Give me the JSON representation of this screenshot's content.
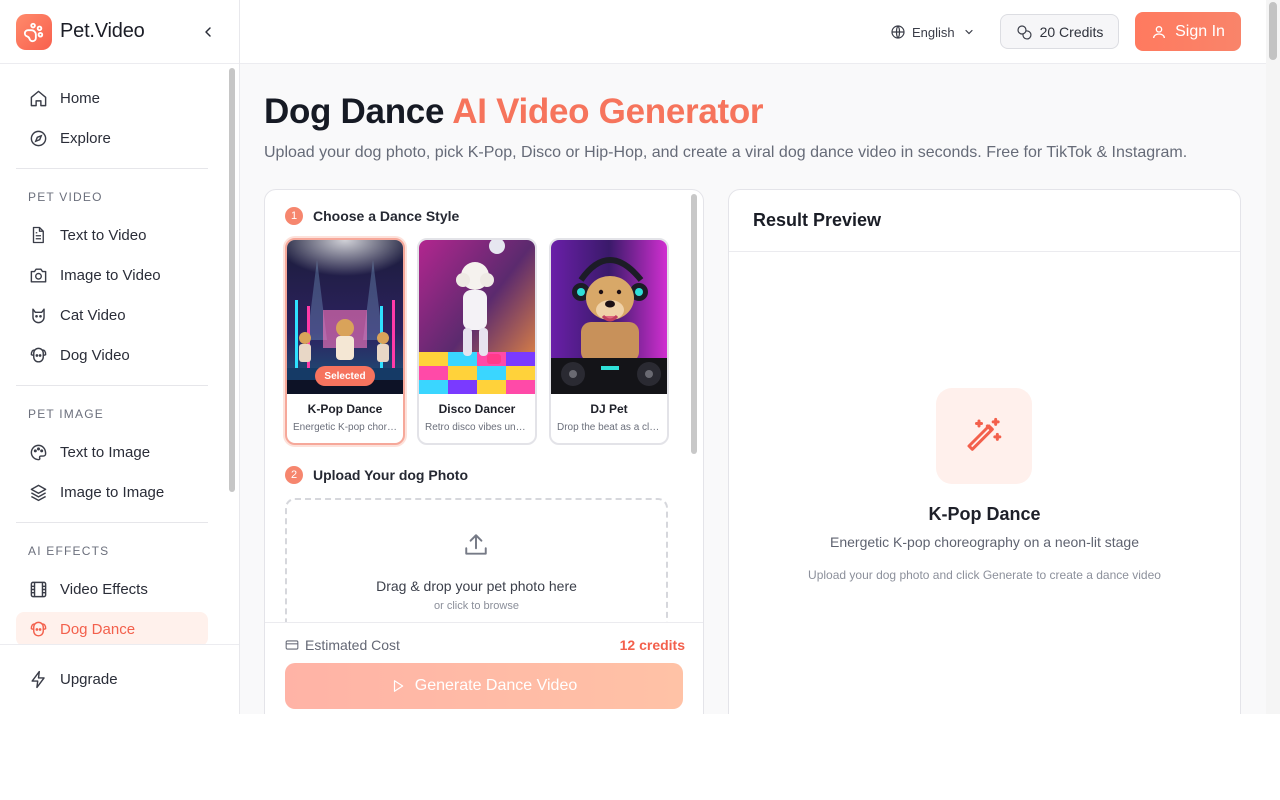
{
  "brand": {
    "name": "Pet.Video"
  },
  "sidebar": {
    "top_items": [
      {
        "label": "Home",
        "icon": "home-icon"
      },
      {
        "label": "Explore",
        "icon": "compass-icon"
      }
    ],
    "sections": [
      {
        "title": "PET VIDEO",
        "items": [
          {
            "label": "Text to Video",
            "icon": "document-icon"
          },
          {
            "label": "Image to Video",
            "icon": "camera-icon"
          },
          {
            "label": "Cat Video",
            "icon": "cat-icon"
          },
          {
            "label": "Dog Video",
            "icon": "dog-icon"
          }
        ]
      },
      {
        "title": "PET IMAGE",
        "items": [
          {
            "label": "Text to Image",
            "icon": "palette-icon"
          },
          {
            "label": "Image to Image",
            "icon": "layers-icon"
          }
        ]
      },
      {
        "title": "AI EFFECTS",
        "items": [
          {
            "label": "Video Effects",
            "icon": "film-icon"
          },
          {
            "label": "Dog Dance",
            "icon": "dog-icon",
            "active": true
          }
        ]
      }
    ],
    "bottom_item": {
      "label": "Upgrade",
      "icon": "lightning-icon"
    }
  },
  "topbar": {
    "language": "English",
    "credits": "20 Credits",
    "sign_in": "Sign In"
  },
  "page": {
    "title_main": "Dog Dance",
    "title_accent": "AI Video Generator",
    "subtitle": "Upload your dog photo, pick K-Pop, Disco or Hip-Hop, and create a viral dog dance video in seconds. Free for TikTok & Instagram."
  },
  "step1": {
    "number": "1",
    "label": "Choose a Dance Style",
    "styles": [
      {
        "title": "K-Pop Dance",
        "desc": "Energetic K-pop choreography on a neon-lit stage",
        "selected": true,
        "badge": "Selected"
      },
      {
        "title": "Disco Dancer",
        "desc": "Retro disco vibes under the mirror ball",
        "selected": false
      },
      {
        "title": "DJ Pet",
        "desc": "Drop the beat as a club DJ",
        "selected": false
      }
    ]
  },
  "step2": {
    "number": "2",
    "label": "Upload Your dog Photo",
    "drop_main": "Drag & drop your pet photo here",
    "drop_sub": "or click to browse"
  },
  "footer": {
    "cost_label": "Estimated Cost",
    "cost_value": "12 credits",
    "generate": "Generate Dance Video"
  },
  "preview": {
    "heading": "Result Preview",
    "title": "K-Pop Dance",
    "desc": "Energetic K-pop choreography on a neon-lit stage",
    "hint": "Upload your dog photo and click Generate to create a dance video"
  },
  "colors": {
    "accent": "#f6745c",
    "active_bg": "#fff1ec",
    "button_gradient_start": "#ff7a5f"
  }
}
